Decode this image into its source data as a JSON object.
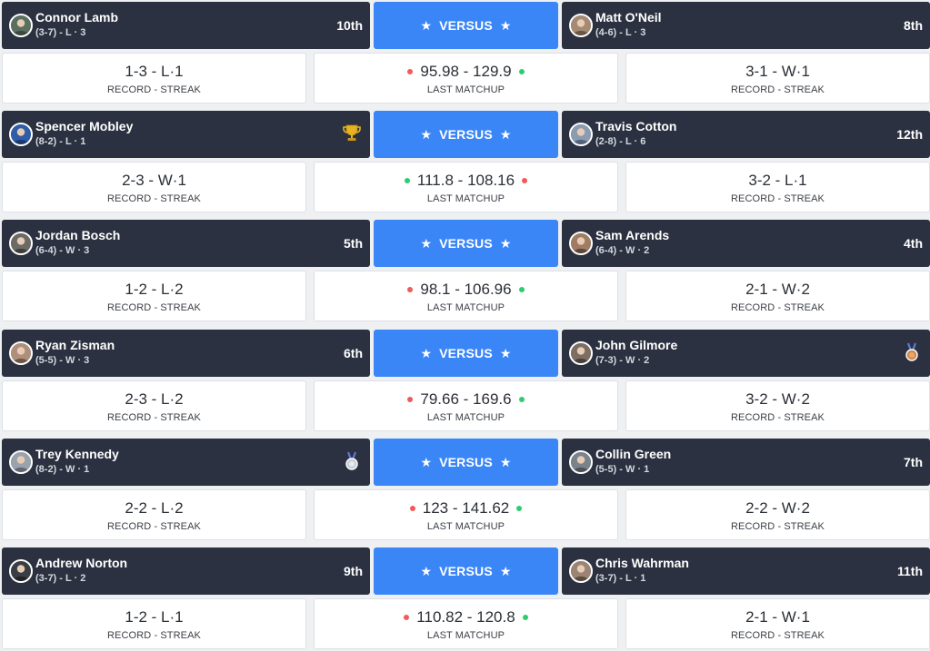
{
  "labels": {
    "versus": "VERSUS",
    "record_streak": "RECORD - STREAK",
    "last_matchup": "LAST MATCHUP"
  },
  "colors": {
    "win": "#2ecc71",
    "loss": "#f05a5a",
    "bar": "#2b3140",
    "accent": "#3b86f7"
  },
  "matchups": [
    {
      "left": {
        "name": "Connor Lamb",
        "sub": "(3-7) - L · 3",
        "rank": "10th",
        "badge": "",
        "h2h": "1-3 - L·1"
      },
      "right": {
        "name": "Matt O'Neil",
        "sub": "(4-6) - L · 3",
        "rank": "8th",
        "badge": "",
        "h2h": "3-1 - W·1"
      },
      "last": {
        "left_score": "95.98",
        "right_score": "129.9",
        "left_result": "loss",
        "right_result": "win"
      }
    },
    {
      "left": {
        "name": "Spencer Mobley",
        "sub": "(8-2) - L · 1",
        "rank": "",
        "badge": "trophy-icon",
        "h2h": "2-3 - W·1"
      },
      "right": {
        "name": "Travis Cotton",
        "sub": "(2-8) - L · 6",
        "rank": "12th",
        "badge": "",
        "h2h": "3-2 - L·1"
      },
      "last": {
        "left_score": "111.8",
        "right_score": "108.16",
        "left_result": "win",
        "right_result": "loss"
      }
    },
    {
      "left": {
        "name": "Jordan Bosch",
        "sub": "(6-4) - W · 3",
        "rank": "5th",
        "badge": "",
        "h2h": "1-2 - L·2"
      },
      "right": {
        "name": "Sam Arends",
        "sub": "(6-4) - W · 2",
        "rank": "4th",
        "badge": "",
        "h2h": "2-1 - W·2"
      },
      "last": {
        "left_score": "98.1",
        "right_score": "106.96",
        "left_result": "loss",
        "right_result": "win"
      }
    },
    {
      "left": {
        "name": "Ryan Zisman",
        "sub": "(5-5) - W · 3",
        "rank": "6th",
        "badge": "",
        "h2h": "2-3 - L·2"
      },
      "right": {
        "name": "John Gilmore",
        "sub": "(7-3) - W · 2",
        "rank": "",
        "badge": "bronze-medal-icon",
        "h2h": "3-2 - W·2"
      },
      "last": {
        "left_score": "79.66",
        "right_score": "169.6",
        "left_result": "loss",
        "right_result": "win"
      }
    },
    {
      "left": {
        "name": "Trey Kennedy",
        "sub": "(8-2) - W · 1",
        "rank": "",
        "badge": "silver-medal-icon",
        "h2h": "2-2 - L·2"
      },
      "right": {
        "name": "Collin Green",
        "sub": "(5-5) - W · 1",
        "rank": "7th",
        "badge": "",
        "h2h": "2-2 - W·2"
      },
      "last": {
        "left_score": "123",
        "right_score": "141.62",
        "left_result": "loss",
        "right_result": "win"
      }
    },
    {
      "left": {
        "name": "Andrew Norton",
        "sub": "(3-7) - L · 2",
        "rank": "9th",
        "badge": "",
        "h2h": "1-2 - L·1"
      },
      "right": {
        "name": "Chris Wahrman",
        "sub": "(3-7) - L · 1",
        "rank": "11th",
        "badge": "",
        "h2h": "2-1 - W·1"
      },
      "last": {
        "left_score": "110.82",
        "right_score": "120.8",
        "left_result": "loss",
        "right_result": "win"
      }
    }
  ]
}
